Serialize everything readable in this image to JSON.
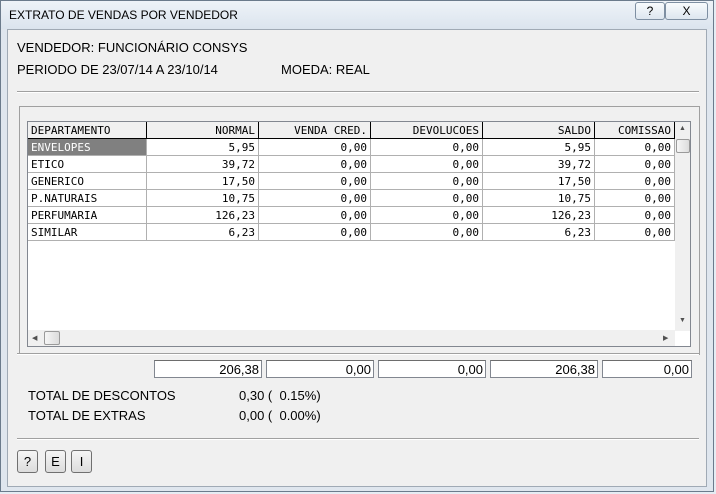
{
  "window": {
    "title": "EXTRATO DE VENDAS POR VENDEDOR",
    "help_label": "?",
    "close_label": "X"
  },
  "info": {
    "vendedor": "VENDEDOR: FUNCIONÁRIO CONSYS",
    "periodo": "PERIODO DE 23/07/14 A 23/10/14",
    "moeda": "MOEDA: REAL"
  },
  "table": {
    "columns": [
      "DEPARTAMENTO",
      "NORMAL",
      "VENDA CRED.",
      "DEVOLUCOES",
      "SALDO",
      "COMISSAO"
    ],
    "rows": [
      [
        "ENVELOPES",
        "5,95",
        "0,00",
        "0,00",
        "5,95",
        "0,00"
      ],
      [
        "ETICO",
        "39,72",
        "0,00",
        "0,00",
        "39,72",
        "0,00"
      ],
      [
        "GENERICO",
        "17,50",
        "0,00",
        "0,00",
        "17,50",
        "0,00"
      ],
      [
        "P.NATURAIS",
        "10,75",
        "0,00",
        "0,00",
        "10,75",
        "0,00"
      ],
      [
        "PERFUMARIA",
        "126,23",
        "0,00",
        "0,00",
        "126,23",
        "0,00"
      ],
      [
        "SIMILAR",
        "6,23",
        "0,00",
        "0,00",
        "6,23",
        "0,00"
      ]
    ],
    "selected_row": 0
  },
  "totals": [
    "206,38",
    "0,00",
    "0,00",
    "206,38",
    "0,00"
  ],
  "summary": {
    "descontos_label": "TOTAL DE DESCONTOS",
    "descontos_value": "0,30 (  0.15%)",
    "extras_label": "TOTAL DE EXTRAS",
    "extras_value": "0,00 (  0.00%)"
  },
  "buttons": {
    "help": "?",
    "e": "E",
    "i": "I"
  },
  "icons": {
    "scroll_up": "up-arrow-icon",
    "scroll_down": "down-arrow-icon",
    "scroll_left": "left-arrow-icon",
    "scroll_right": "right-arrow-icon"
  }
}
